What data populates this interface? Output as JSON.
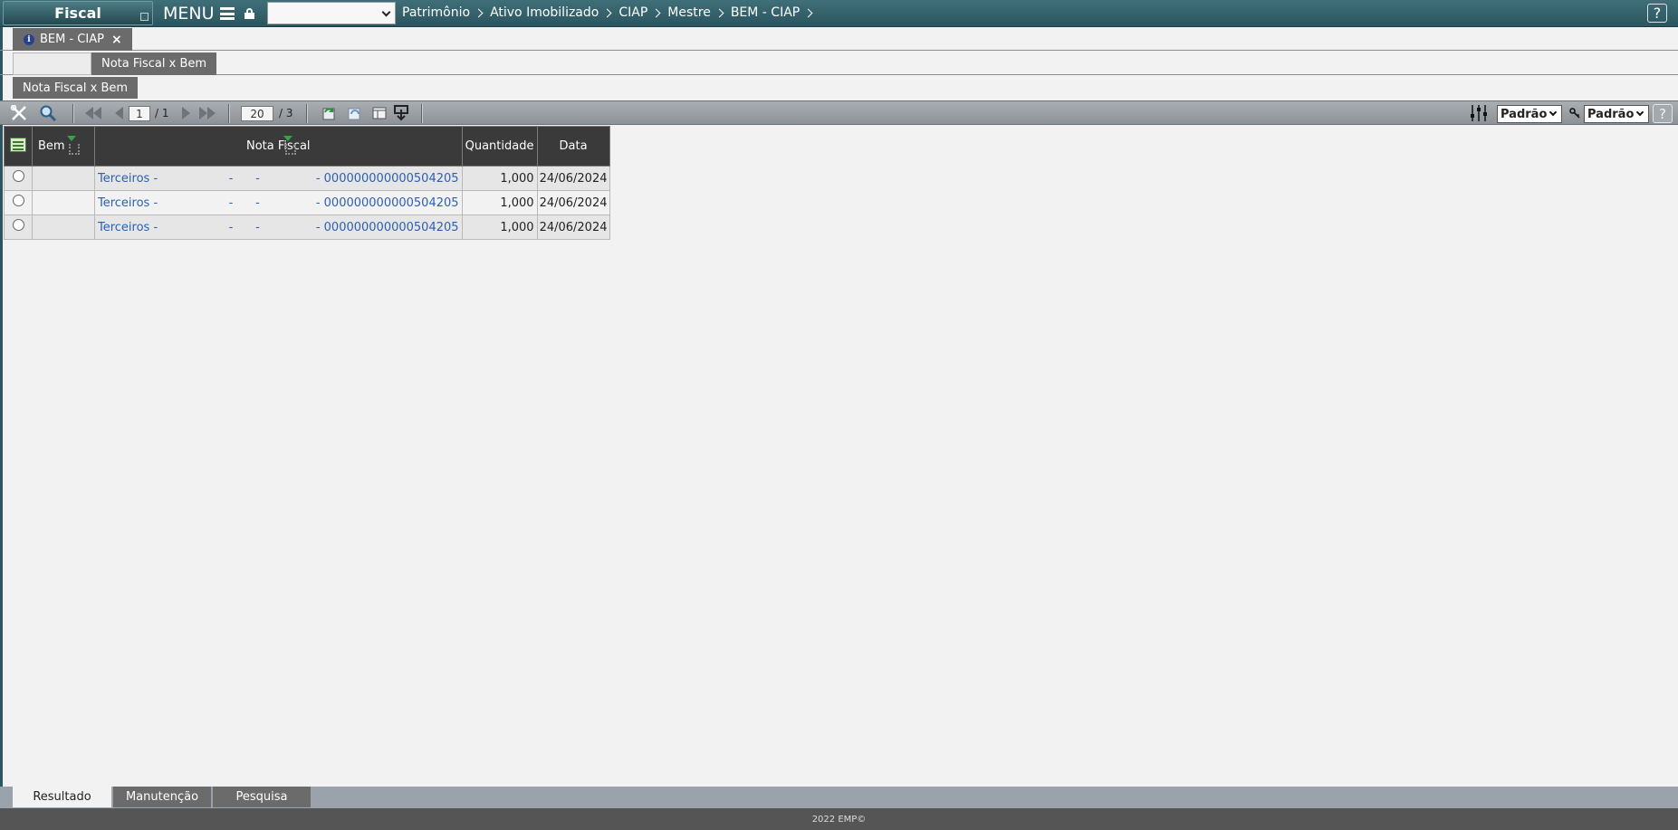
{
  "app": {
    "title": "Fiscal",
    "menu_label": "MENU"
  },
  "module_select": {
    "value": ""
  },
  "breadcrumb": [
    "Patrimônio",
    "Ativo Imobilizado",
    "CIAP",
    "Mestre",
    "BEM - CIAP"
  ],
  "help_label": "?",
  "window_tab": {
    "label": "BEM - CIAP",
    "close": "×",
    "info": "i"
  },
  "subtabs": {
    "active": "Nota Fiscal x Bem"
  },
  "section_tab": "Nota Fiscal x Bem",
  "toolbar": {
    "page_current": "1",
    "page_total": "/ 1",
    "page_size": "20",
    "records_total": "/ 3",
    "view_select": "Padrão",
    "filter_select": "Padrão",
    "help": "?"
  },
  "grid": {
    "columns": {
      "bem": "Bem",
      "nota_fiscal": "Nota Fiscal",
      "quantidade": "Quantidade",
      "data": "Data"
    },
    "rows": [
      {
        "nf_text": "Terceiros -                   -      -               - 000000000000504205",
        "quantidade": "1,000",
        "data": "24/06/2024"
      },
      {
        "nf_text": "Terceiros -                   -      -               - 000000000000504205",
        "quantidade": "1,000",
        "data": "24/06/2024"
      },
      {
        "nf_text": "Terceiros -                   -      -               - 000000000000504205",
        "quantidade": "1,000",
        "data": "24/06/2024"
      }
    ]
  },
  "bottom_tabs": [
    "Resultado",
    "Manutenção",
    "Pesquisa"
  ],
  "footer": "2022 EMP©"
}
